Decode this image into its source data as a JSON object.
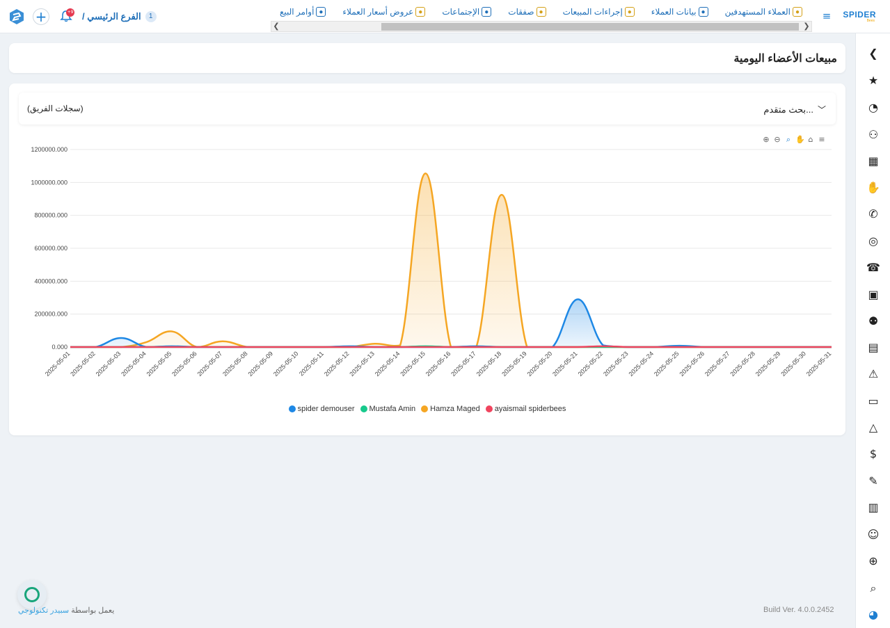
{
  "topbar": {
    "logo": "SPIDER",
    "logo_sub": "Bees",
    "branch_number": "1",
    "branch_name": "الفرع الرئيسي /",
    "notification_count": "+9",
    "nav": [
      {
        "label": "العملاء المستهدفين",
        "icon": "target-customers-icon",
        "color": "#d4a017"
      },
      {
        "label": "بيانات العملاء",
        "icon": "customer-data-icon",
        "color": "#1f6fb8"
      },
      {
        "label": "إجراءات المبيعات",
        "icon": "sales-actions-icon",
        "color": "#d4a017"
      },
      {
        "label": "صفقات",
        "icon": "deals-icon",
        "color": "#d4a017"
      },
      {
        "label": "الإجتماعات",
        "icon": "meetings-icon",
        "color": "#1f6fb8"
      },
      {
        "label": "عروض أسعار العملاء",
        "icon": "quotations-icon",
        "color": "#d4a017"
      },
      {
        "label": "أوامر البيع",
        "icon": "sales-orders-icon",
        "color": "#1f6fb8"
      }
    ]
  },
  "page": {
    "title": "مبيعات الأعضاء اليومية",
    "advanced_search": "بحث متقدم...",
    "team_records": "(سجلات الفريق)"
  },
  "chart_data": {
    "type": "area",
    "x": [
      "2025-05-01",
      "2025-05-02",
      "2025-05-03",
      "2025-05-04",
      "2025-05-05",
      "2025-05-06",
      "2025-05-07",
      "2025-05-08",
      "2025-05-09",
      "2025-05-10",
      "2025-05-11",
      "2025-05-12",
      "2025-05-13",
      "2025-05-14",
      "2025-05-15",
      "2025-05-16",
      "2025-05-17",
      "2025-05-18",
      "2025-05-19",
      "2025-05-20",
      "2025-05-21",
      "2025-05-22",
      "2025-05-23",
      "2025-05-24",
      "2025-05-25",
      "2025-05-26",
      "2025-05-27",
      "2025-05-28",
      "2025-05-29",
      "2025-05-30",
      "2025-05-31"
    ],
    "y_ticks": [
      "1200000.000",
      "1000000.000",
      "800000.000",
      "600000.000",
      "400000.000",
      "200000.000",
      "0.000"
    ],
    "ylim": [
      0,
      1200000
    ],
    "series": [
      {
        "name": "spider demouser",
        "color": "#1e88e5",
        "values": [
          0,
          0,
          55000,
          0,
          5000,
          0,
          0,
          0,
          0,
          0,
          0,
          5000,
          0,
          0,
          0,
          0,
          5000,
          0,
          0,
          0,
          290000,
          10000,
          0,
          0,
          8000,
          0,
          0,
          0,
          0,
          0,
          0
        ]
      },
      {
        "name": "Mustafa Amin",
        "color": "#17c98c",
        "values": [
          0,
          0,
          0,
          0,
          0,
          0,
          0,
          0,
          0,
          0,
          0,
          0,
          0,
          0,
          5000,
          0,
          0,
          0,
          0,
          0,
          0,
          0,
          0,
          0,
          0,
          0,
          0,
          0,
          0,
          0,
          0
        ]
      },
      {
        "name": "Hamza Maged",
        "color": "#f5a623",
        "values": [
          0,
          0,
          0,
          30000,
          95000,
          0,
          35000,
          0,
          0,
          0,
          0,
          0,
          20000,
          10000,
          1055000,
          0,
          0,
          925000,
          0,
          0,
          0,
          0,
          0,
          0,
          0,
          0,
          0,
          0,
          0,
          0,
          0
        ]
      },
      {
        "name": "ayaismail spiderbees",
        "color": "#f0445e",
        "values": [
          0,
          0,
          0,
          0,
          0,
          0,
          0,
          0,
          0,
          0,
          0,
          0,
          0,
          0,
          0,
          0,
          0,
          0,
          0,
          0,
          0,
          5000,
          0,
          0,
          0,
          0,
          0,
          0,
          0,
          0,
          0
        ]
      }
    ],
    "grid": true,
    "legend_position": "bottom"
  },
  "footer": {
    "powered_prefix": "يعمل بواسطة",
    "powered_brand": "سبيدر تكنولوجي",
    "build": "Build Ver. 4.0.0.2452"
  }
}
